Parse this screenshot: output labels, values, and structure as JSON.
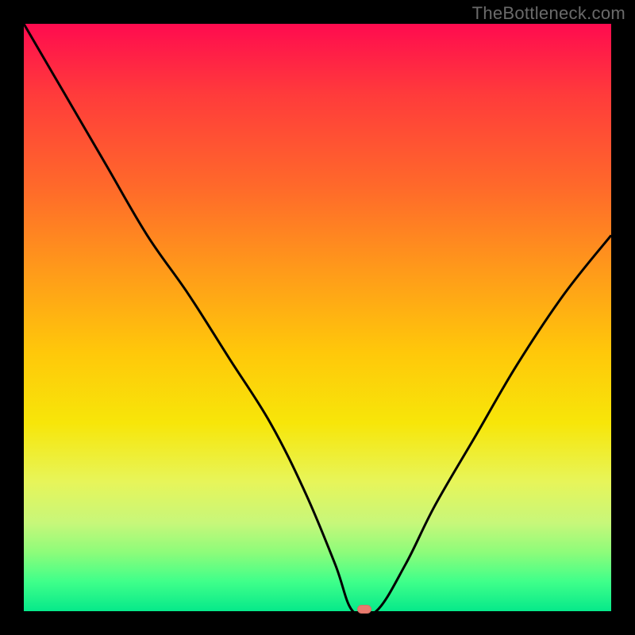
{
  "watermark": "TheBottleneck.com",
  "chart_data": {
    "type": "line",
    "title": "",
    "xlabel": "",
    "ylabel": "",
    "xlim": [
      0,
      100
    ],
    "ylim": [
      0,
      100
    ],
    "grid": false,
    "series": [
      {
        "name": "bottleneck-curve",
        "x": [
          0,
          7,
          14,
          21,
          28,
          35,
          42,
          48,
          53,
          56,
          60,
          65,
          70,
          77,
          84,
          92,
          100
        ],
        "values": [
          100,
          88,
          76,
          64,
          54,
          43,
          32,
          20,
          8,
          0,
          0,
          8,
          18,
          30,
          42,
          54,
          64
        ]
      }
    ],
    "minimum_marker": {
      "x_center": 58,
      "y": 0
    },
    "gradient_stops": [
      {
        "pct": 0,
        "color": "#ff0b4f"
      },
      {
        "pct": 12,
        "color": "#ff3b3b"
      },
      {
        "pct": 28,
        "color": "#ff6a2a"
      },
      {
        "pct": 42,
        "color": "#ff9a1a"
      },
      {
        "pct": 56,
        "color": "#ffc80a"
      },
      {
        "pct": 68,
        "color": "#f7e609"
      },
      {
        "pct": 78,
        "color": "#e7f55a"
      },
      {
        "pct": 85,
        "color": "#c7f77a"
      },
      {
        "pct": 90,
        "color": "#8dfc7a"
      },
      {
        "pct": 95,
        "color": "#3fff8a"
      },
      {
        "pct": 100,
        "color": "#06e98a"
      }
    ]
  }
}
